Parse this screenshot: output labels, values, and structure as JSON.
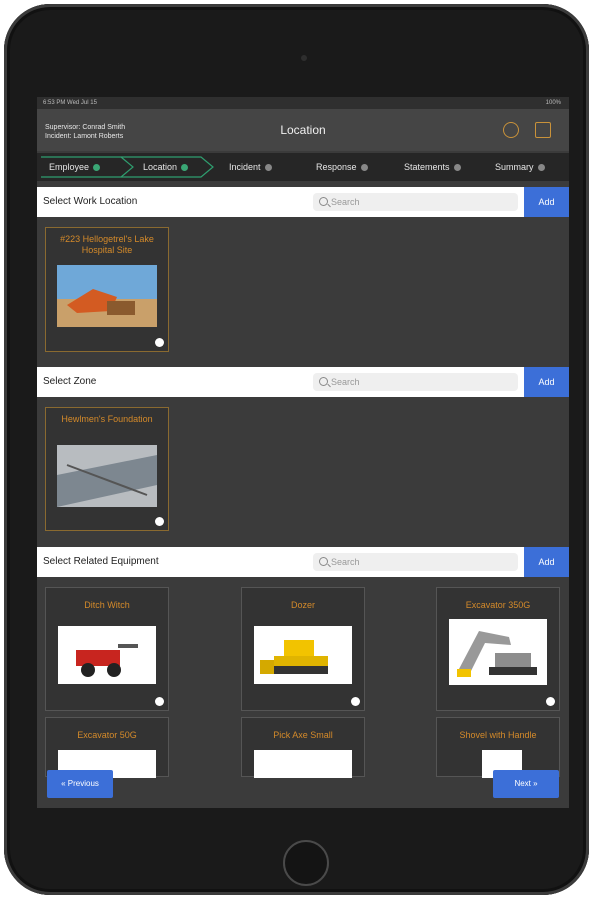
{
  "status": {
    "time": "6:53 PM  Wed Jul 15",
    "battery": "100%"
  },
  "header": {
    "supervisor": "Supervisor: Conrad Smith",
    "incident": "Incident: Lamont Roberts",
    "title": "Location"
  },
  "steps": [
    "Employee",
    "Location",
    "Incident",
    "Response",
    "Statements",
    "Summary"
  ],
  "sections": {
    "location": {
      "label": "Select Work Location",
      "placeholder": "Search",
      "add": "Add"
    },
    "zone": {
      "label": "Select Zone",
      "placeholder": "Search",
      "add": "Add"
    },
    "equipment": {
      "label": "Select Related Equipment",
      "placeholder": "Search",
      "add": "Add"
    }
  },
  "location_cards": [
    {
      "title": "#223 Hellogetrel's Lake Hospital Site"
    }
  ],
  "zone_cards": [
    {
      "title": "Hewlmen's Foundation"
    }
  ],
  "equipment_cards": [
    {
      "title": "Ditch Witch"
    },
    {
      "title": "Dozer"
    },
    {
      "title": "Excavator 350G"
    },
    {
      "title": "Excavator 50G"
    },
    {
      "title": "Pick Axe Small"
    },
    {
      "title": "Shovel with Handle"
    }
  ],
  "nav": {
    "previous": "« Previous",
    "next": "Next »"
  },
  "colors": {
    "accent": "#3c6fd8",
    "card_title": "#d48a2a",
    "screen_bg": "#3b3b3b"
  }
}
